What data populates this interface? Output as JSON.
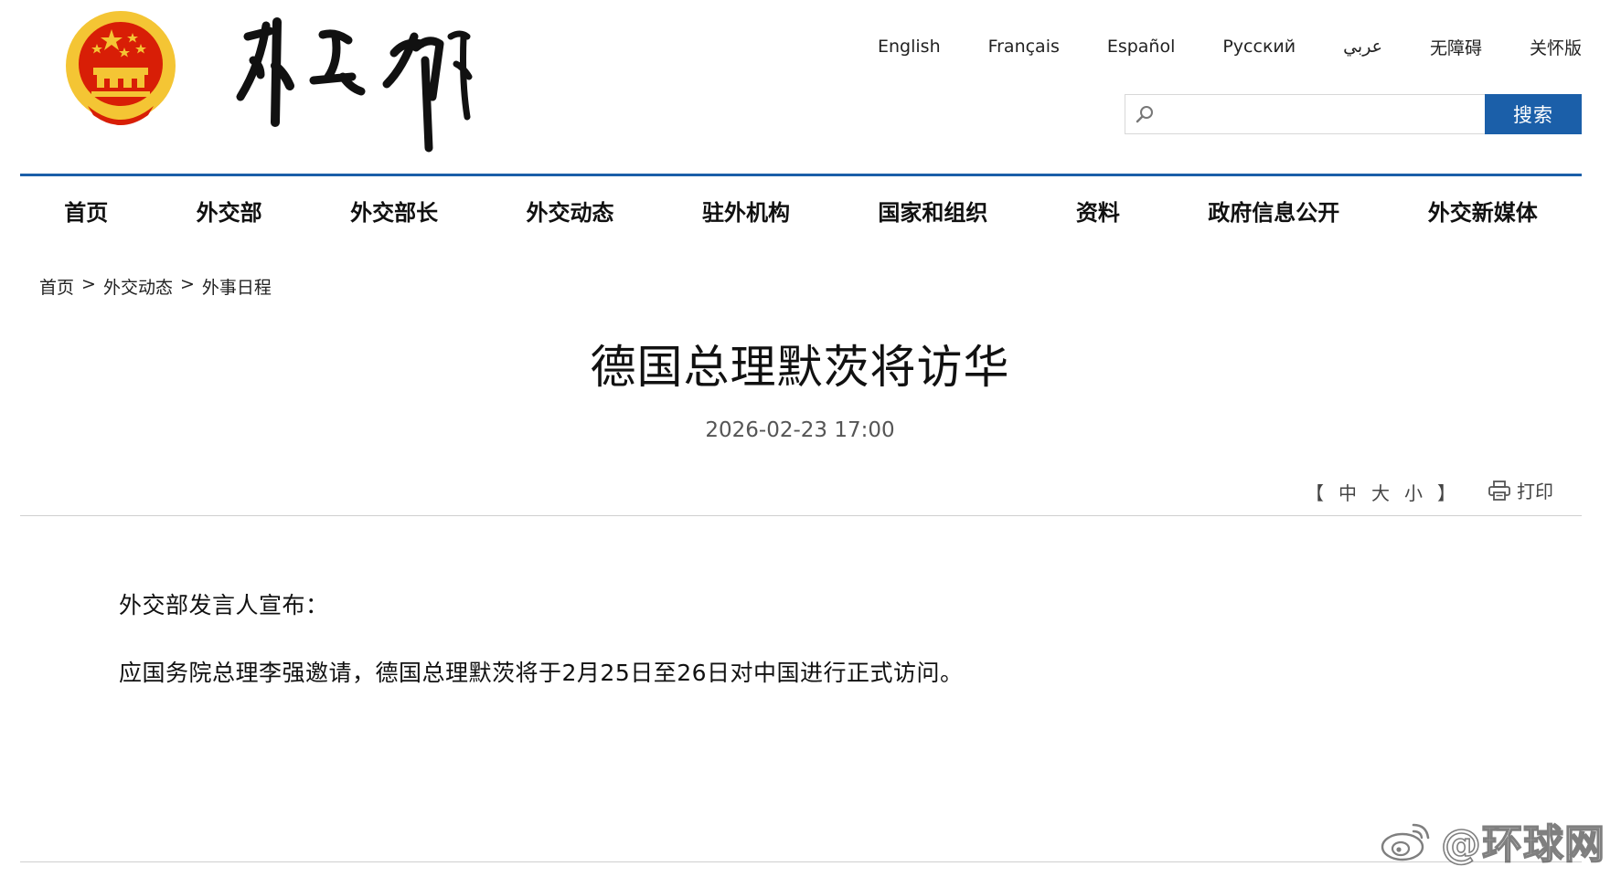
{
  "colors": {
    "brand": "#1b5fa9",
    "emblem_red": "#d81e06",
    "emblem_gold": "#f4c534"
  },
  "header": {
    "languages": [
      "English",
      "Français",
      "Español",
      "Русский",
      "عربي",
      "无障碍",
      "关怀版"
    ],
    "search": {
      "placeholder": "",
      "button_label": "搜索",
      "icon": "search-icon"
    }
  },
  "nav": {
    "items": [
      "首页",
      "外交部",
      "外交部长",
      "外交动态",
      "驻外机构",
      "国家和组织",
      "资料",
      "政府信息公开",
      "外交新媒体"
    ]
  },
  "breadcrumb": {
    "items": [
      "首页",
      "外交动态",
      "外事日程"
    ],
    "separator": ">"
  },
  "article": {
    "title": "德国总理默茨将访华",
    "date": "2026-02-23 17:00",
    "font_size": {
      "open": "【",
      "sizes": [
        "中",
        "大",
        "小"
      ],
      "close": "】"
    },
    "print_label": "打印",
    "paragraphs": [
      "外交部发言人宣布：",
      "应国务院总理李强邀请，德国总理默茨将于2月25日至26日对中国进行正式访问。"
    ]
  },
  "watermark": {
    "text": "@环球网",
    "icon": "weibo-icon"
  }
}
